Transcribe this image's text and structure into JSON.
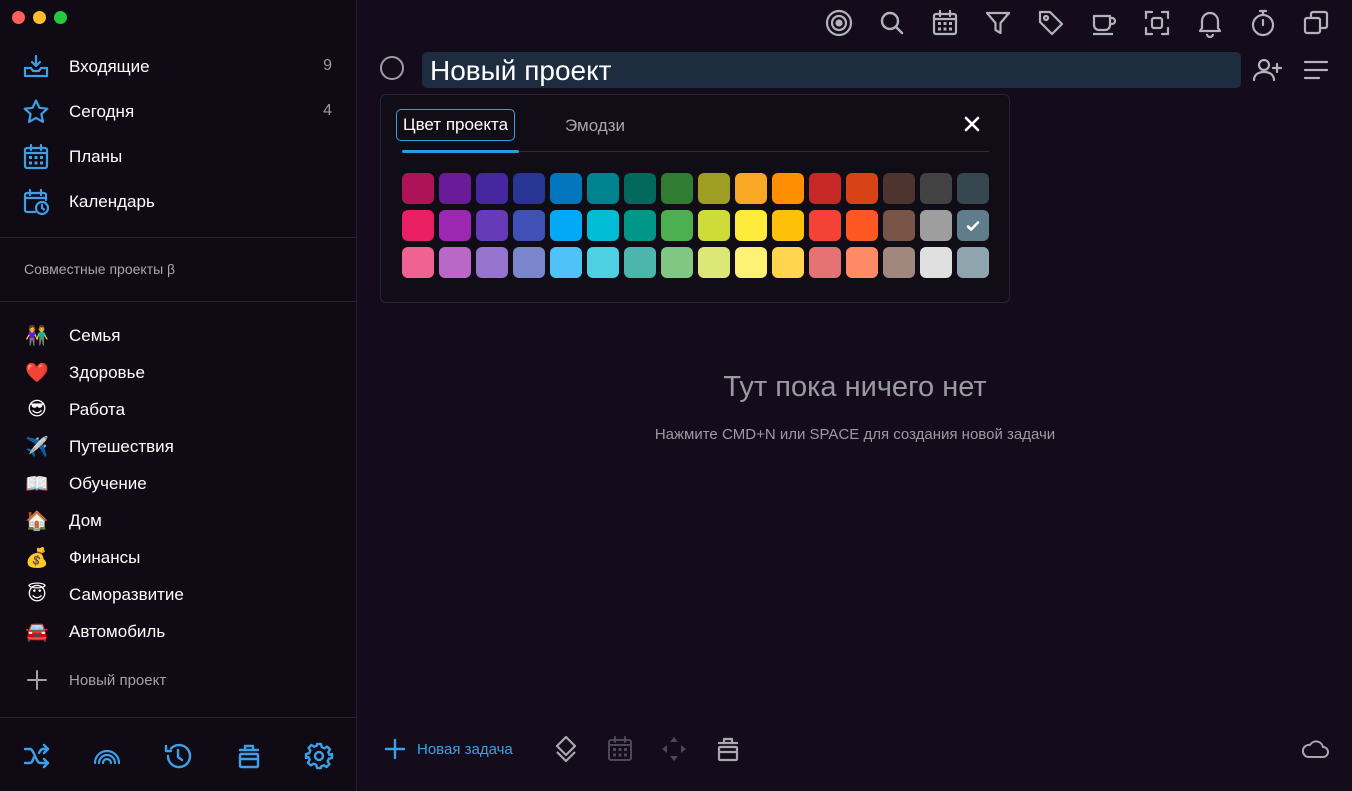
{
  "colors": {
    "accent": "#3d9fe6",
    "window_close": "#ff5f57",
    "window_minimize": "#febc2e",
    "window_maximize": "#28c840"
  },
  "sidebar": {
    "nav": [
      {
        "icon": "inbox-icon",
        "label": "Входящие",
        "count": "9"
      },
      {
        "icon": "star-icon",
        "label": "Сегодня",
        "count": "4"
      },
      {
        "icon": "calendar-grid-icon",
        "label": "Планы",
        "count": ""
      },
      {
        "icon": "calendar-clock-icon",
        "label": "Календарь",
        "count": ""
      }
    ],
    "shared_title": "Совместные проекты β",
    "projects": [
      {
        "emoji": "👫",
        "label": "Семья"
      },
      {
        "emoji": "❤️",
        "label": "Здоровье"
      },
      {
        "emoji": "😎",
        "label": "Работа"
      },
      {
        "emoji": "✈️",
        "label": "Путешествия"
      },
      {
        "emoji": "📖",
        "label": "Обучение"
      },
      {
        "emoji": "🏠",
        "label": "Дом"
      },
      {
        "emoji": "💰",
        "label": "Финансы"
      },
      {
        "emoji": "😇",
        "label": "Саморазвитие"
      },
      {
        "emoji": "🚘",
        "label": "Автомобиль"
      }
    ],
    "new_project_label": "Новый проект",
    "bottom_icons": [
      "shuffle-icon",
      "rainbow-icon",
      "history-icon",
      "trash-icon",
      "settings-icon"
    ]
  },
  "toolbar_icons": [
    "focus-icon",
    "search-icon",
    "calendar-icon",
    "filter-icon",
    "tag-icon",
    "coffee-icon",
    "scan-icon",
    "bell-icon",
    "timer-icon",
    "windows-icon"
  ],
  "project": {
    "title": "Новый проект",
    "header_icons": [
      "add-member-icon",
      "menu-icon"
    ]
  },
  "picker": {
    "tab_color": "Цвет проекта",
    "tab_emoji": "Эмодзи",
    "selected_color": "#607d8b",
    "rows": [
      [
        "#ad1457",
        "#6a1b9a",
        "#4527a0",
        "#283593",
        "#0277bd",
        "#00838f",
        "#00695c",
        "#2e7d32",
        "#9e9d24",
        "#f9a825",
        "#ff8f00",
        "#c62828",
        "#d84315",
        "#4e342e",
        "#424242",
        "#37474f"
      ],
      [
        "#e91e63",
        "#9c27b0",
        "#673ab7",
        "#3f51b5",
        "#03a9f4",
        "#00bcd4",
        "#009688",
        "#4caf50",
        "#cddc39",
        "#ffeb3b",
        "#ffc107",
        "#f44336",
        "#ff5722",
        "#795548",
        "#9e9e9e",
        "#607d8b"
      ],
      [
        "#f06292",
        "#ba68c8",
        "#9575cd",
        "#7986cb",
        "#4fc3f7",
        "#4dd0e1",
        "#4db6ac",
        "#81c784",
        "#dce775",
        "#fff176",
        "#ffd54f",
        "#e57373",
        "#ff8a65",
        "#a1887f",
        "#e0e0e0",
        "#90a4ae"
      ]
    ]
  },
  "empty_state": {
    "title": "Тут пока ничего нет",
    "subtitle": "Нажмите CMD+N или SPACE для создания новой задачи"
  },
  "footer": {
    "new_task_label": "Новая задача",
    "icons": [
      "stack-icon",
      "calendar-icon",
      "move-icon",
      "trash-icon"
    ],
    "cloud_icon": "cloud-icon"
  }
}
